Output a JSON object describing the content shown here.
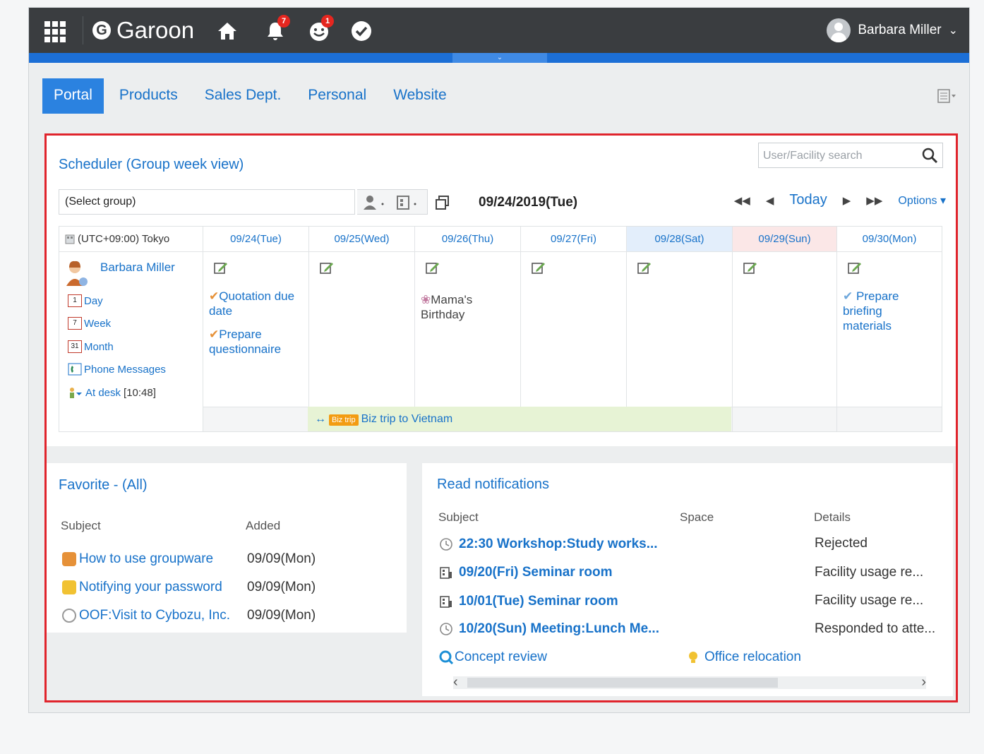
{
  "topbar": {
    "app_name": "Garoon",
    "notif_badge": "7",
    "mention_badge": "1",
    "user_name": "Barbara Miller",
    "colors": {
      "bar": "#3a3d40",
      "accent": "#1c6fd6",
      "badge": "#e5261f"
    }
  },
  "tabs": [
    {
      "label": "Portal"
    },
    {
      "label": "Products"
    },
    {
      "label": "Sales Dept."
    },
    {
      "label": "Personal"
    },
    {
      "label": "Website"
    }
  ],
  "scheduler": {
    "title": "Scheduler (Group week view)",
    "search_placeholder": "User/Facility search",
    "group_select": "(Select group)",
    "date": "09/24/2019(Tue)",
    "today": "Today",
    "options": "Options",
    "timezone": "(UTC+09:00) Tokyo",
    "user": "Barbara Miller",
    "links": [
      {
        "label": "Day",
        "icon": "1"
      },
      {
        "label": "Week",
        "icon": "7"
      },
      {
        "label": "Month",
        "icon": "31"
      },
      {
        "label": "Phone Messages",
        "icon": "phone"
      },
      {
        "label": "At desk",
        "icon": "desk",
        "extra": "[10:48]"
      }
    ],
    "days": [
      {
        "label": "09/24(Tue)",
        "kind": "weekday"
      },
      {
        "label": "09/25(Wed)",
        "kind": "weekday"
      },
      {
        "label": "09/26(Thu)",
        "kind": "weekday"
      },
      {
        "label": "09/27(Fri)",
        "kind": "weekday"
      },
      {
        "label": "09/28(Sat)",
        "kind": "sat"
      },
      {
        "label": "09/29(Sun)",
        "kind": "sun"
      },
      {
        "label": "09/30(Mon)",
        "kind": "weekday"
      }
    ],
    "events": {
      "tue_1": "Quotation due date",
      "tue_2": "Prepare questionnaire",
      "thu_1": "Mama's Birthday",
      "mon_1": "Prepare briefing materials"
    },
    "banner_tag": "Biz trip",
    "banner_text": "Biz trip to Vietnam"
  },
  "favorite": {
    "title": "Favorite - (All)",
    "col_subject": "Subject",
    "col_added": "Added",
    "rows": [
      {
        "subject": "How to use groupware",
        "added": "09/09(Mon)"
      },
      {
        "subject": "Notifying your password",
        "added": "09/09(Mon)"
      },
      {
        "subject": "OOF:Visit to Cybozu, Inc.",
        "added": "09/09(Mon)"
      }
    ]
  },
  "notifications": {
    "title": "Read notifications",
    "col_subject": "Subject",
    "col_space": "Space",
    "col_details": "Details",
    "rows": [
      {
        "subject": "22:30 Workshop:Study works...",
        "details": "Rejected"
      },
      {
        "subject": "09/20(Fri) Seminar room",
        "details": "Facility usage re..."
      },
      {
        "subject": "10/01(Tue) Seminar room",
        "details": "Facility usage re..."
      },
      {
        "subject": "10/20(Sun) Meeting:Lunch Me...",
        "details": "Responded to atte..."
      }
    ],
    "space_row": {
      "subject": "Concept review",
      "space": "Office relocation"
    }
  }
}
